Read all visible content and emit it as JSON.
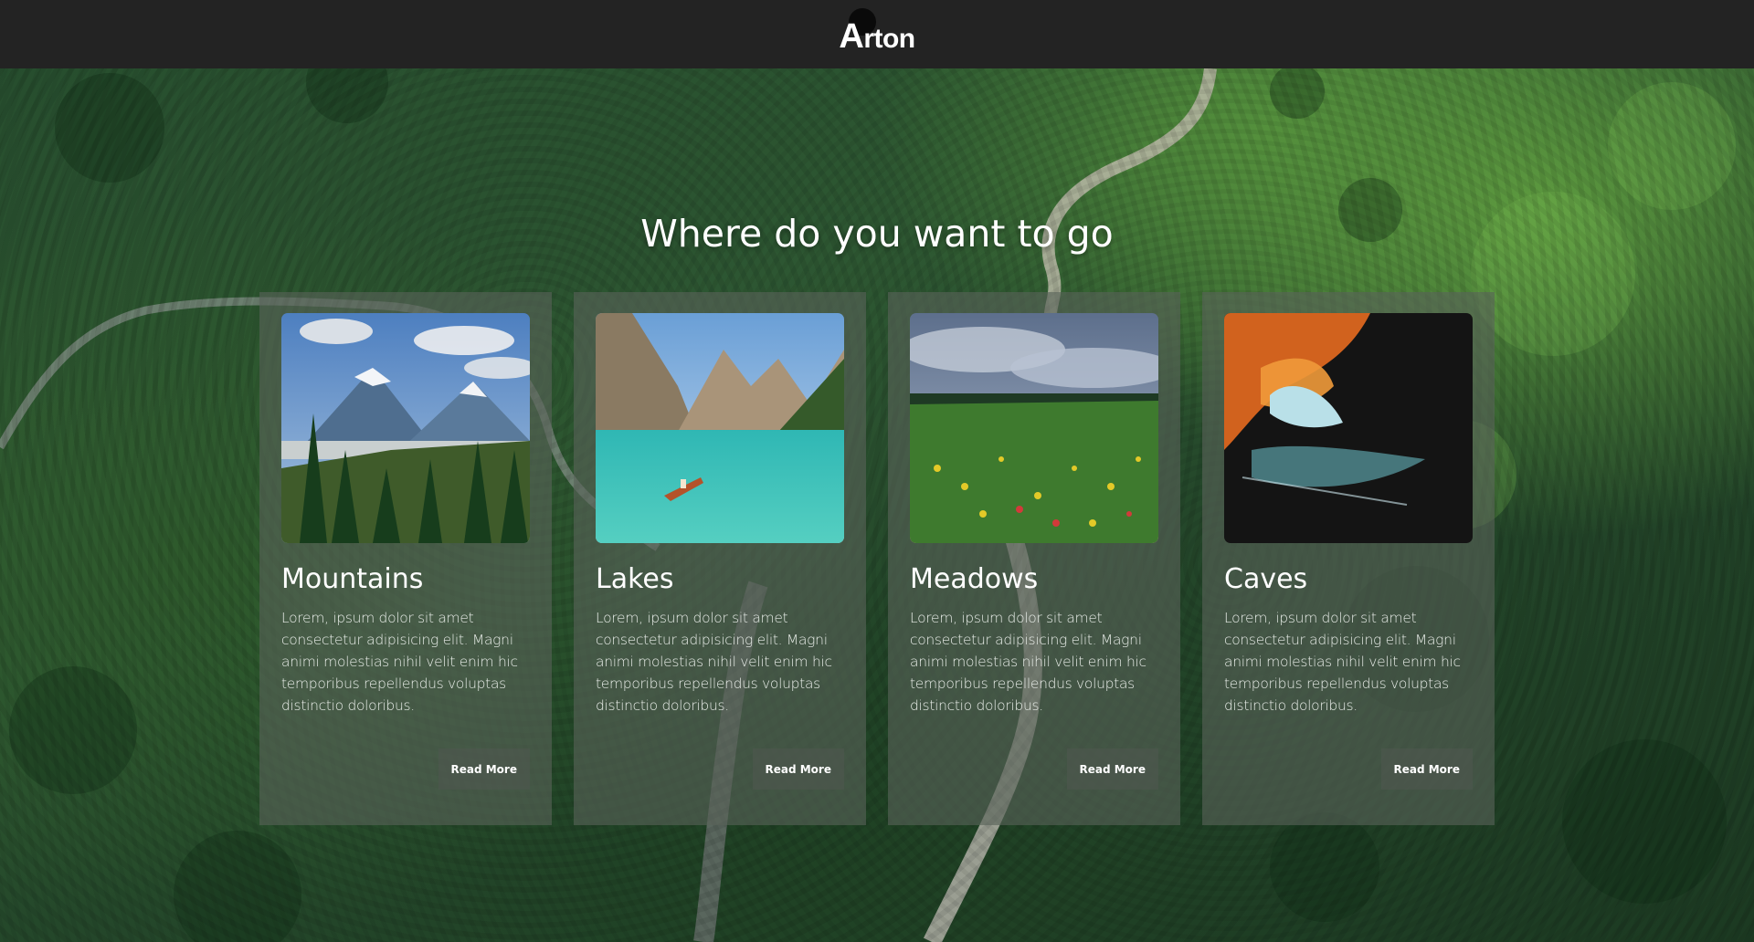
{
  "header": {
    "logo_first": "A",
    "logo_rest": "rton"
  },
  "hero": {
    "heading": "Where do you want to go"
  },
  "cards": [
    {
      "title": "Mountains",
      "text": "Lorem, ipsum dolor sit amet consectetur adipisicing elit. Magni animi molestias nihil velit enim hic temporibus repellendus voluptas distinctio doloribus.",
      "button": "Read More",
      "image": "mountains-photo"
    },
    {
      "title": "Lakes",
      "text": "Lorem, ipsum dolor sit amet consectetur adipisicing elit. Magni animi molestias nihil velit enim hic temporibus repellendus voluptas distinctio doloribus.",
      "button": "Read More",
      "image": "lake-photo"
    },
    {
      "title": "Meadows",
      "text": "Lorem, ipsum dolor sit amet consectetur adipisicing elit. Magni animi molestias nihil velit enim hic temporibus repellendus voluptas distinctio doloribus.",
      "button": "Read More",
      "image": "meadow-photo"
    },
    {
      "title": "Caves",
      "text": "Lorem, ipsum dolor sit amet consectetur adipisicing elit. Magni animi molestias nihil velit enim hic temporibus repellendus voluptas distinctio doloribus.",
      "button": "Read More",
      "image": "cave-photo"
    }
  ],
  "colors": {
    "header_bg": "#232323",
    "card_bg": "#586358",
    "forest": "#2f5a33"
  }
}
